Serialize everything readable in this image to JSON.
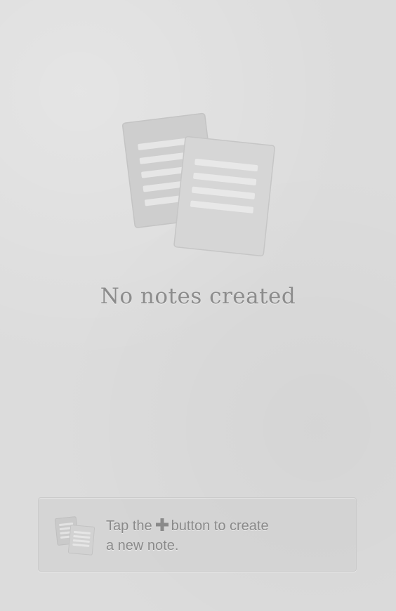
{
  "empty_state": {
    "title": "No notes created",
    "illustration_icon": "documents-icon"
  },
  "hint": {
    "icon": "documents-icon",
    "text_before": "Tap the",
    "plus_icon": "plus-icon",
    "text_after": "button to create",
    "text_line2": "a new note."
  },
  "colors": {
    "background": "#dcdcdc",
    "text": "#8c8c8c",
    "illustration": "#cfcfcf"
  }
}
